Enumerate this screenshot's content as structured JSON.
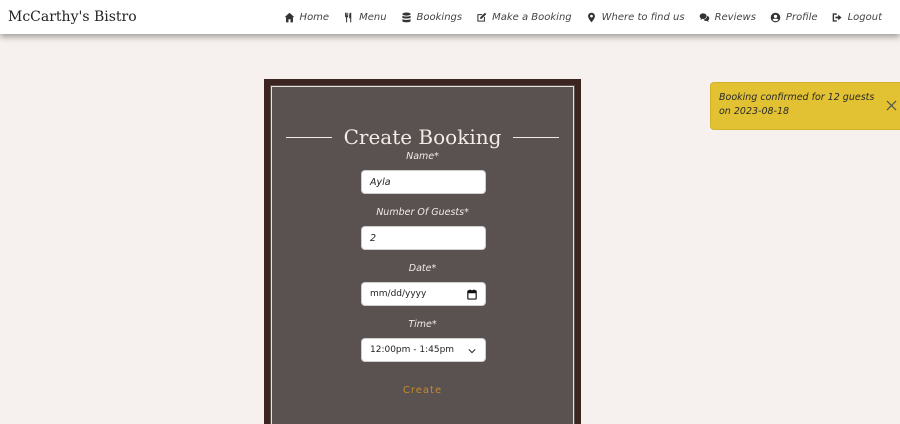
{
  "brand": {
    "name": "McCarthy's Bistro"
  },
  "nav": {
    "items": [
      {
        "label": "Home",
        "icon": "home-icon"
      },
      {
        "label": "Menu",
        "icon": "utensils-icon"
      },
      {
        "label": "Bookings",
        "icon": "database-icon"
      },
      {
        "label": "Make a Booking",
        "icon": "edit-icon"
      },
      {
        "label": "Where to find us",
        "icon": "map-marker-icon"
      },
      {
        "label": "Reviews",
        "icon": "comments-icon"
      },
      {
        "label": "Profile",
        "icon": "user-circle-icon"
      },
      {
        "label": "Logout",
        "icon": "sign-out-icon"
      }
    ]
  },
  "form": {
    "title": "Create Booking",
    "name_label": "Name*",
    "name_value": "Ayla",
    "guests_label": "Number Of Guests*",
    "guests_value": "2",
    "date_label": "Date*",
    "date_placeholder": "mm/dd/yyyy",
    "time_label": "Time*",
    "time_value": "12:00pm - 1:45pm",
    "submit_label": "Create"
  },
  "toast": {
    "message": "Booking confirmed for 12 guests on 2023-08-18"
  },
  "colors": {
    "page_bg": "#f6f1ee",
    "card_bg": "#5a5250",
    "card_border": "#3c2520",
    "toast_bg": "#e2c232",
    "accent": "#c88a2a"
  }
}
